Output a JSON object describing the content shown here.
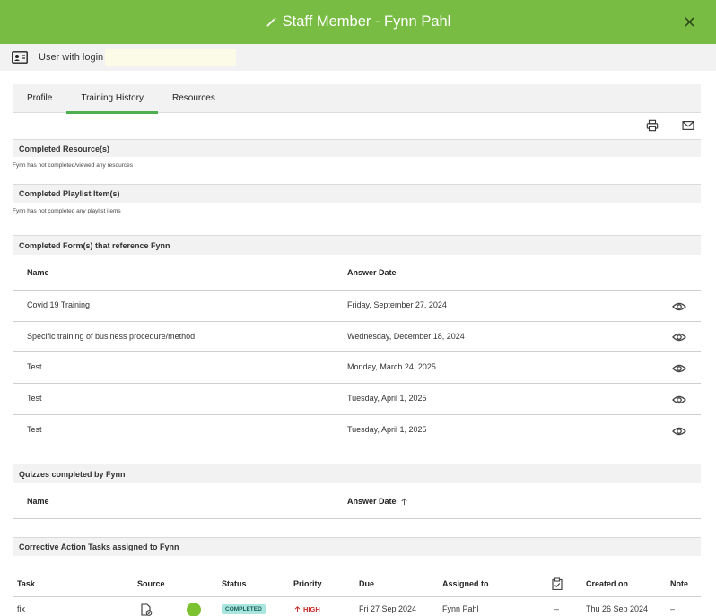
{
  "header": {
    "title": "Staff Member - Fynn Pahl",
    "pencil_icon": "pencil-icon",
    "close_icon": "close-icon",
    "bg": "#79bc43"
  },
  "user": {
    "label": "User with login",
    "icon": "id-card-icon"
  },
  "tabs": [
    {
      "label": "Profile",
      "active": false
    },
    {
      "label": "Training History",
      "active": true
    },
    {
      "label": "Resources",
      "active": false
    }
  ],
  "toolbar": {
    "print_icon": "print-icon",
    "mail_icon": "mail-icon"
  },
  "sections": {
    "resources": {
      "title": "Completed Resource(s)",
      "note": "Fynn has not completed/viewed any resources"
    },
    "playlist": {
      "title": "Completed Playlist Item(s)",
      "note": "Fynn has not completed any playlist items"
    },
    "forms": {
      "title": "Completed Form(s) that reference Fynn",
      "columns": {
        "name": "Name",
        "date": "Answer Date"
      },
      "rows": [
        {
          "name": "Covid 19 Training",
          "date": "Friday, September 27, 2024"
        },
        {
          "name": "Specific training of business procedure/method",
          "date": "Wednesday, December 18, 2024"
        },
        {
          "name": "Test",
          "date": "Monday, March 24, 2025"
        },
        {
          "name": "Test",
          "date": "Tuesday, April 1, 2025"
        },
        {
          "name": "Test",
          "date": "Tuesday, April 1, 2025"
        }
      ]
    },
    "quizzes": {
      "title": "Quizzes completed by Fynn",
      "columns": {
        "name": "Name",
        "date": "Answer Date"
      }
    },
    "tasks": {
      "title": "Corrective Action Tasks assigned to Fynn",
      "columns": {
        "task": "Task",
        "source": "Source",
        "status": "Status",
        "priority": "Priority",
        "due": "Due",
        "assigned": "Assigned to",
        "created": "Created on",
        "note": "Note"
      },
      "rows": [
        {
          "task": "fix",
          "status": "COMPLETED",
          "priority": "HIGH",
          "due": "Fri 27 Sep 2024",
          "assigned": "Fynn Pahl",
          "checklist": "–",
          "created": "Thu 26 Sep 2024",
          "note": "–"
        }
      ]
    }
  },
  "colors": {
    "accent": "#79bc43",
    "tab_underline": "#4caf50",
    "status_badge": "#a8e6df",
    "priority": "#c62828",
    "status_dot": "#7cc12f"
  }
}
